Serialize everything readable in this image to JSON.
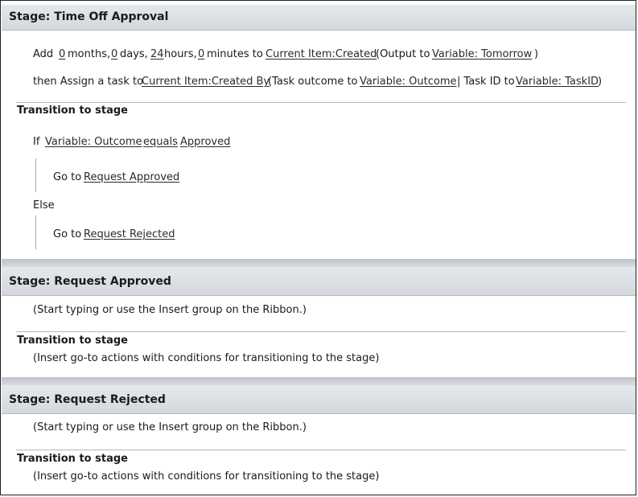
{
  "stages": [
    {
      "title": "Stage: Time Off Approval",
      "add_action": {
        "prefix": "Add",
        "months_value": "0",
        "months_label": "months,",
        "days_value": "0",
        "days_label": "days,",
        "hours_value": "24",
        "hours_label": "hours,",
        "minutes_value": "0",
        "minutes_label": "minutes to",
        "date_field": "Current Item:Created",
        "output_open": "(Output to",
        "output_var": "Variable: Tomorrow",
        "output_close": ")"
      },
      "assign_action": {
        "prefix": "then Assign a task to",
        "assignee": "Current Item:Created By",
        "outcome_open": "(Task outcome to",
        "outcome_var": "Variable: Outcome",
        "separator": "| Task ID to",
        "taskid_var": "Variable: TaskID",
        "close": ")"
      },
      "transition": {
        "header": "Transition to stage",
        "if_keyword": "If",
        "condition_var": "Variable: Outcome",
        "condition_op": "equals",
        "condition_value": "Approved",
        "goto_label": "Go to",
        "goto_if_target": "Request Approved",
        "else_keyword": "Else",
        "goto_else_target": "Request Rejected"
      }
    },
    {
      "title": "Stage: Request Approved",
      "placeholder": "(Start typing or use the Insert group on the Ribbon.)",
      "transition": {
        "header": "Transition to stage",
        "hint": "(Insert go-to actions with conditions for transitioning to the stage)"
      }
    },
    {
      "title": "Stage: Request Rejected",
      "placeholder": "(Start typing or use the Insert group on the Ribbon.)",
      "transition": {
        "header": "Transition to stage",
        "hint": "(Insert go-to actions with conditions for transitioning to the stage)"
      }
    }
  ]
}
